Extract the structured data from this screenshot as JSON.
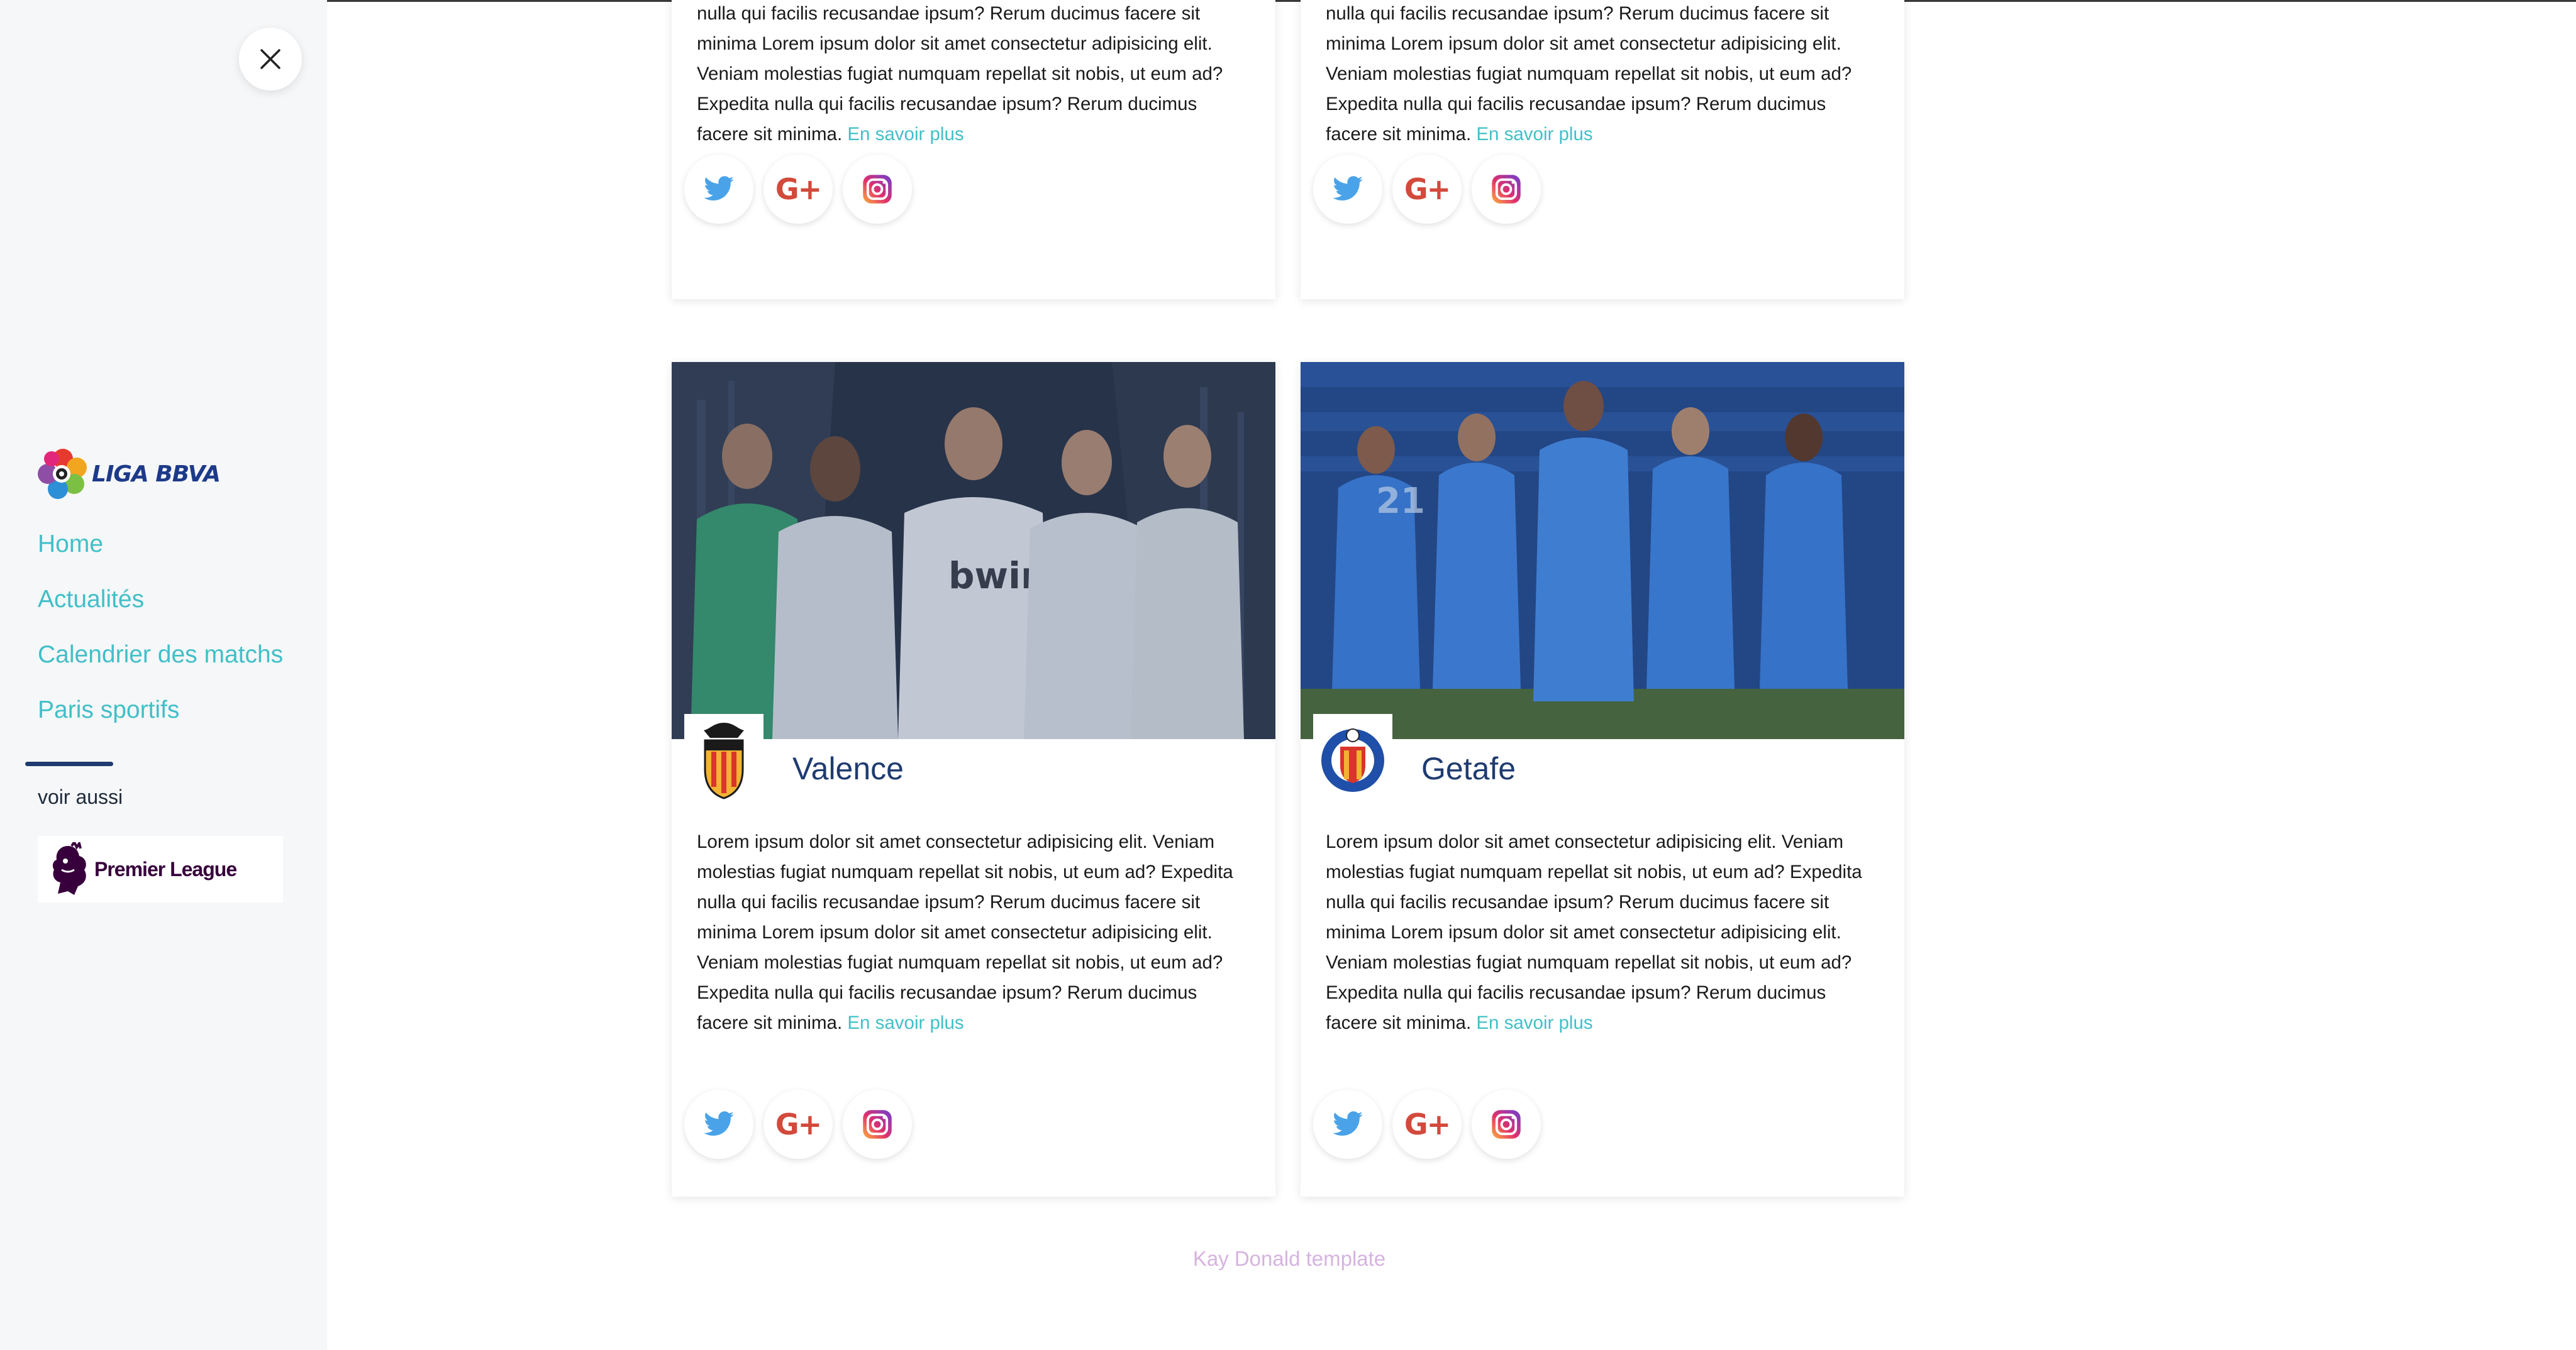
{
  "sidebar": {
    "close_label": "close",
    "logo_text": "LIGA BBVA",
    "nav": [
      {
        "label": "Home"
      },
      {
        "label": "Actualités"
      },
      {
        "label": "Calendrier des matchs"
      },
      {
        "label": "Paris sportifs"
      }
    ],
    "see_also": "voir aussi",
    "partner_logo_text": "Premier League"
  },
  "cards_top": [
    {
      "text": "nulla qui facilis recusandae ipsum? Rerum ducimus facere sit minima Lorem ipsum dolor sit amet consectetur adipisicing elit. Veniam molestias fugiat numquam repellat sit nobis, ut eum ad? Expedita nulla qui facilis recusandae ipsum? Rerum ducimus facere sit minima.",
      "link": "En savoir plus"
    },
    {
      "text": "nulla qui facilis recusandae ipsum? Rerum ducimus facere sit minima Lorem ipsum dolor sit amet consectetur adipisicing elit. Veniam molestias fugiat numquam repellat sit nobis, ut eum ad? Expedita nulla qui facilis recusandae ipsum? Rerum ducimus facere sit minima.",
      "link": "En savoir plus"
    }
  ],
  "cards": [
    {
      "team": "Valence",
      "crest_icon": "valencia-crest-icon",
      "image": "valencia-players-photo",
      "text": "Lorem ipsum dolor sit amet consectetur adipisicing elit. Veniam molestias fugiat numquam repellat sit nobis, ut eum ad? Expedita nulla qui facilis recusandae ipsum? Rerum ducimus facere sit minima Lorem ipsum dolor sit amet consectetur adipisicing elit. Veniam molestias fugiat numquam repellat sit nobis, ut eum ad? Expedita nulla qui facilis recusandae ipsum? Rerum ducimus facere sit minima.",
      "link": "En savoir plus"
    },
    {
      "team": "Getafe",
      "crest_icon": "getafe-crest-icon",
      "image": "getafe-players-photo",
      "text": "Lorem ipsum dolor sit amet consectetur adipisicing elit. Veniam molestias fugiat numquam repellat sit nobis, ut eum ad? Expedita nulla qui facilis recusandae ipsum? Rerum ducimus facere sit minima Lorem ipsum dolor sit amet consectetur adipisicing elit. Veniam molestias fugiat numquam repellat sit nobis, ut eum ad? Expedita nulla qui facilis recusandae ipsum? Rerum ducimus facere sit minima.",
      "link": "En savoir plus"
    }
  ],
  "social": {
    "icons": [
      "twitter-icon",
      "google-plus-icon",
      "instagram-icon"
    ],
    "gplus_glyph": "G+"
  },
  "footer": "Kay Donald template",
  "colors": {
    "accent": "#41bfc8",
    "title": "#1f3b70",
    "sidebar_bg": "#f6f7f8",
    "footer_text": "#d6b3e0",
    "twitter": "#4aa3e8",
    "google_plus": "#d24a3c"
  }
}
